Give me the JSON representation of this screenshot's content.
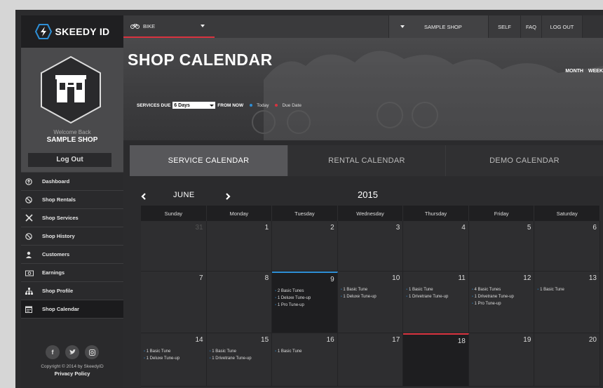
{
  "brand": {
    "name": "SKEEDY ID"
  },
  "sidebar": {
    "welcome": "Welcome Back",
    "shop_name": "SAMPLE SHOP",
    "logout": "Log Out",
    "items": [
      {
        "label": "Dashboard",
        "icon": "arrow-up-circle-icon"
      },
      {
        "label": "Shop Rentals",
        "icon": "no-sign-icon"
      },
      {
        "label": "Shop Services",
        "icon": "tools-icon"
      },
      {
        "label": "Shop History",
        "icon": "no-sign-icon"
      },
      {
        "label": "Customers",
        "icon": "user-icon"
      },
      {
        "label": "Earnings",
        "icon": "money-icon"
      },
      {
        "label": "Shop Profile",
        "icon": "org-chart-icon"
      },
      {
        "label": "Shop Calendar",
        "icon": "calendar-icon"
      }
    ],
    "active_item": "Shop Calendar",
    "social": [
      "f",
      "twitter",
      "instagram"
    ],
    "copyright": "Copyright © 2014 by SkeedyID",
    "privacy": "Privacy Policy"
  },
  "topbar": {
    "bike": "BIKE",
    "shop": "SAMPLE SHOP",
    "self": "SELF",
    "faq": "FAQ",
    "logout": "LOG OUT"
  },
  "page": {
    "title": "SHOP CALENDAR",
    "view_month": "MONTH",
    "view_week": "WEEK",
    "services_due_label": "SERVICES DUE",
    "days_value": "6 Days",
    "from_now": "FROM NOW",
    "legend_today": "Today",
    "legend_due": "Due Date",
    "today_color": "#2e8fd6",
    "due_color": "#d9333f"
  },
  "tabs": [
    "SERVICE CALENDAR",
    "RENTAL CALENDAR",
    "DEMO CALENDAR"
  ],
  "calendar": {
    "month": "JUNE",
    "year": "2015",
    "days_of_week": [
      "Sunday",
      "Monday",
      "Tuesday",
      "Wednesday",
      "Thursday",
      "Friday",
      "Saturday"
    ],
    "weeks": [
      [
        {
          "day": "31",
          "dim": true,
          "events": []
        },
        {
          "day": "1",
          "events": []
        },
        {
          "day": "2",
          "events": []
        },
        {
          "day": "3",
          "events": []
        },
        {
          "day": "4",
          "events": []
        },
        {
          "day": "5",
          "events": []
        },
        {
          "day": "6",
          "events": []
        }
      ],
      [
        {
          "day": "7",
          "events": []
        },
        {
          "day": "8",
          "events": []
        },
        {
          "day": "9",
          "state": "today",
          "events": [
            "2 Basic Tunes",
            "1 Deluxe Tune-up",
            "1 Pro Tune-up"
          ]
        },
        {
          "day": "10",
          "events": [
            "1 Basic Tune",
            "1 Deluxe Tune-up"
          ]
        },
        {
          "day": "11",
          "events": [
            "1 Basic Tune",
            "1 Drivetrane Tune-up"
          ]
        },
        {
          "day": "12",
          "events": [
            "4 Basic Tunes",
            "1 Drivetrane Tune-up",
            "1 Pro Tune-up"
          ]
        },
        {
          "day": "13",
          "events": [
            "1 Basic Tune"
          ]
        }
      ],
      [
        {
          "day": "14",
          "events": [
            "1 Basic Tune",
            "1 Deluxe Tune-up"
          ]
        },
        {
          "day": "15",
          "events": [
            "1 Basic Tune",
            "1 Drivetrane Tune-up"
          ]
        },
        {
          "day": "16",
          "events": [
            "1 Basic Tune"
          ]
        },
        {
          "day": "17",
          "events": []
        },
        {
          "day": "18",
          "state": "due",
          "events": []
        },
        {
          "day": "19",
          "events": []
        },
        {
          "day": "20",
          "events": []
        }
      ]
    ]
  }
}
